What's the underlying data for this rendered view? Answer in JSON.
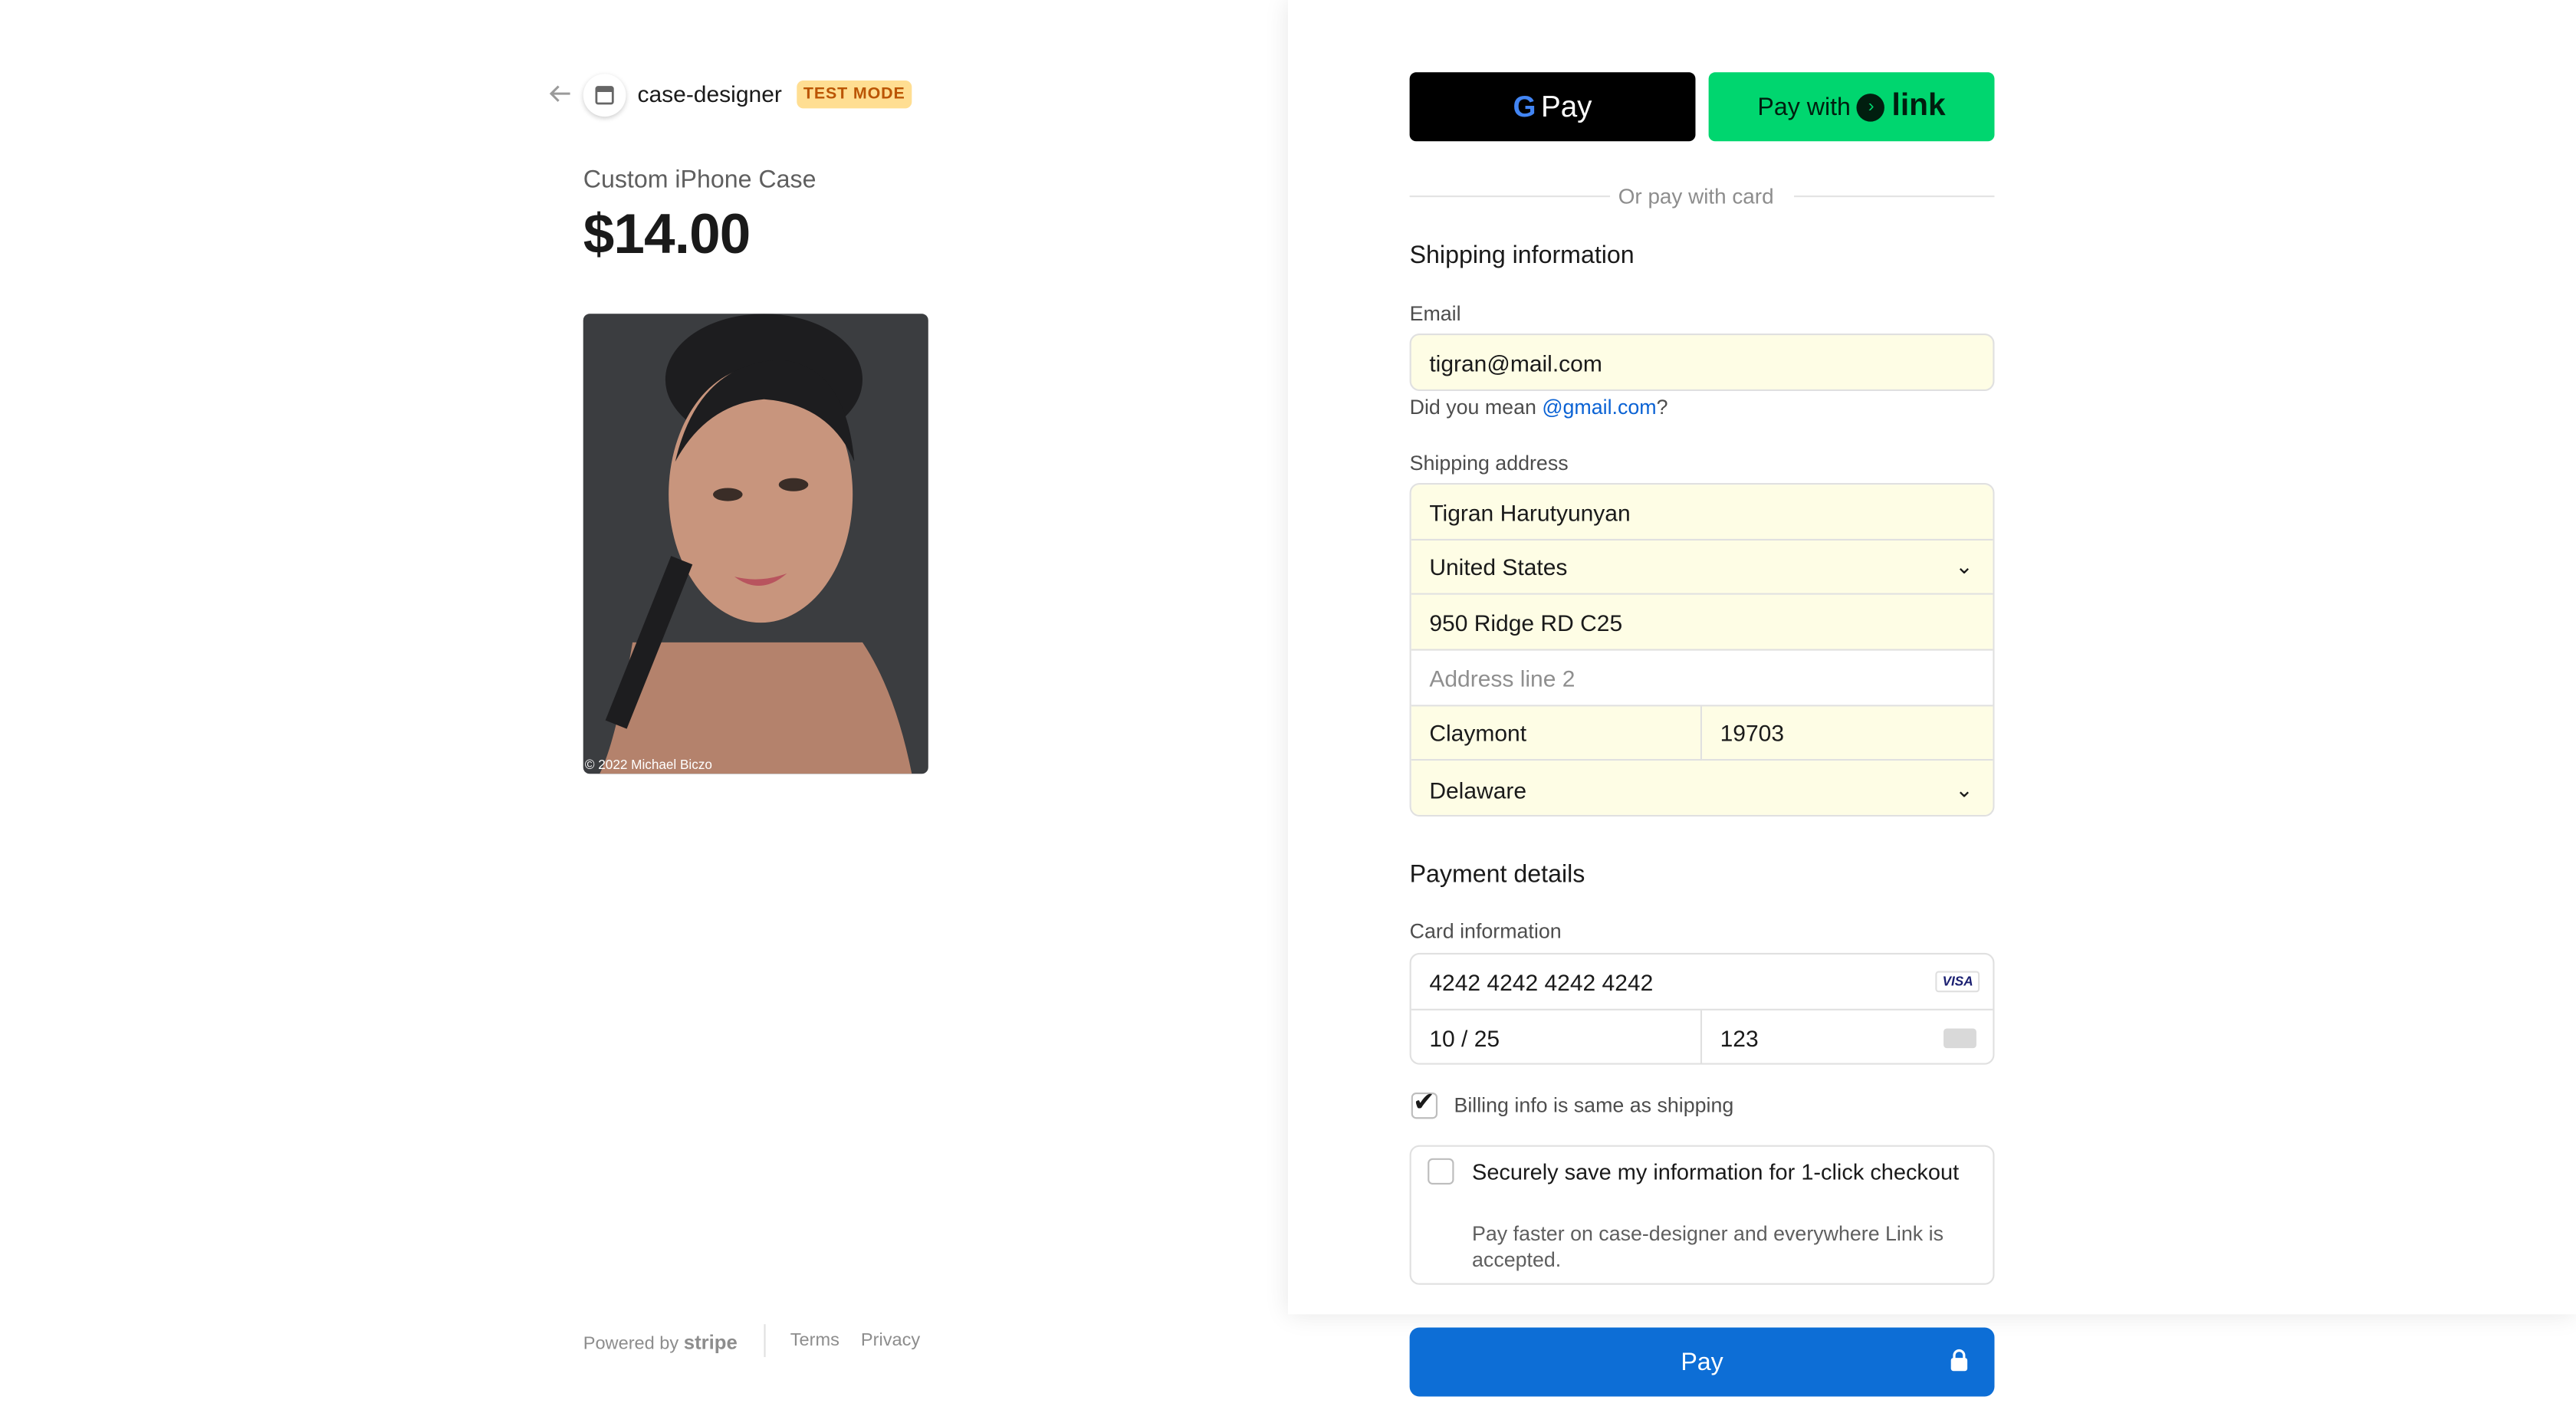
{
  "store": {
    "name": "case-designer",
    "badge": "TEST MODE"
  },
  "product": {
    "name": "Custom iPhone Case",
    "price": "$14.00",
    "photo_credit": "© 2022 Michael Biczo"
  },
  "footer": {
    "powered_by": "Powered by",
    "stripe": "stripe",
    "terms": "Terms",
    "privacy": "Privacy"
  },
  "wallets": {
    "gpay_label": "Pay",
    "link_prefix": "Pay with",
    "link_word": "link"
  },
  "divider": "Or pay with card",
  "shipping": {
    "title": "Shipping information",
    "email_label": "Email",
    "email": "tigran@mail.com",
    "hint_prefix": "Did you mean ",
    "hint_suggestion": "@gmail.com",
    "hint_suffix": "?",
    "address_label": "Shipping address",
    "name": "Tigran Harutyunyan",
    "country": "United States",
    "line1": "950 Ridge RD C25",
    "line2_placeholder": "Address line 2",
    "city": "Claymont",
    "zip": "19703",
    "state": "Delaware"
  },
  "payment": {
    "title": "Payment details",
    "card_label": "Card information",
    "card_number": "4242 4242 4242 4242",
    "card_brand": "VISA",
    "expiry": "10 / 25",
    "cvc": "123",
    "billing_same": "Billing info is same as shipping",
    "billing_checked": true,
    "save_title": "Securely save my information for 1-click checkout",
    "save_sub": "Pay faster on case-designer and everywhere Link is accepted.",
    "pay_label": "Pay"
  },
  "colors": {
    "pay_button": "#0d6ed6",
    "link_button": "#00d66f",
    "autofill": "#fefde5",
    "badge": "#ffde92"
  }
}
